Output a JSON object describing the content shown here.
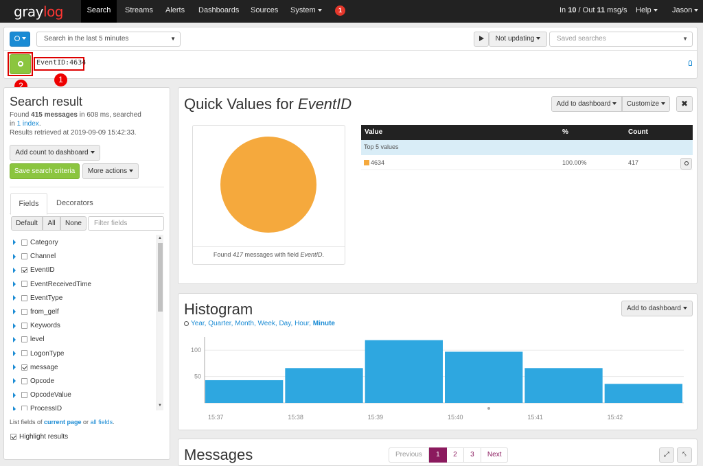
{
  "nav": {
    "logo_a": "gray",
    "logo_b": "log",
    "items": [
      "Search",
      "Streams",
      "Alerts",
      "Dashboards",
      "Sources",
      "System"
    ],
    "badge": "1",
    "throughput_prefix": "In ",
    "throughput_in": "10",
    "throughput_mid": " / Out ",
    "throughput_out": "11",
    "throughput_suffix": " msg/s",
    "help": "Help",
    "user": "Jason"
  },
  "search": {
    "range": "Search in the last 5 minutes",
    "updating": "Not updating",
    "saved_placeholder": "Saved searches",
    "query": "EventID:4634",
    "annotation_1": "1",
    "annotation_2": "2"
  },
  "sidebar": {
    "title": "Search result",
    "found_prefix": "Found ",
    "found_count": "415 messages",
    "found_mid": " in 608 ms, searched",
    "in_prefix": "in ",
    "index_link": "1 index",
    "in_suffix": ".",
    "retrieved": "Results retrieved at 2019-09-09 15:42:33.",
    "add_count": "Add count to dashboard",
    "save_criteria": "Save search criteria",
    "more_actions": "More actions",
    "tab_fields": "Fields",
    "tab_decorators": "Decorators",
    "filter_default": "Default",
    "filter_all": "All",
    "filter_none": "None",
    "filter_placeholder": "Filter fields",
    "fields": [
      {
        "name": "Category",
        "checked": false
      },
      {
        "name": "Channel",
        "checked": false
      },
      {
        "name": "EventID",
        "checked": true
      },
      {
        "name": "EventReceivedTime",
        "checked": false
      },
      {
        "name": "EventType",
        "checked": false
      },
      {
        "name": "from_gelf",
        "checked": false
      },
      {
        "name": "Keywords",
        "checked": false
      },
      {
        "name": "level",
        "checked": false
      },
      {
        "name": "LogonType",
        "checked": false
      },
      {
        "name": "message",
        "checked": true
      },
      {
        "name": "Opcode",
        "checked": false
      },
      {
        "name": "OpcodeValue",
        "checked": false
      },
      {
        "name": "ProcessID",
        "checked": false
      }
    ],
    "list_fields_prefix": "List fields of ",
    "current_page": "current page",
    "list_fields_mid": " or ",
    "all_fields": "all fields",
    "list_fields_suffix": ".",
    "highlight": "Highlight results"
  },
  "quick_values": {
    "title_prefix": "Quick Values for ",
    "title_field": "EventID",
    "add_to_dashboard": "Add to dashboard",
    "customize": "Customize",
    "pie_caption_prefix": "Found ",
    "pie_caption_count": "417",
    "pie_caption_mid": " messages with field ",
    "pie_caption_field": "EventID",
    "pie_caption_suffix": ".",
    "table_headers": [
      "Value",
      "%",
      "Count"
    ],
    "group_label": "Top 5 values",
    "rows": [
      {
        "value": "4634",
        "percent": "100.00%",
        "count": "417",
        "color": "#f5a93d"
      }
    ]
  },
  "histogram": {
    "title": "Histogram",
    "add_to_dashboard": "Add to dashboard",
    "resolutions": [
      "Year",
      "Quarter",
      "Month",
      "Week",
      "Day",
      "Hour",
      "Minute"
    ],
    "active_resolution": "Minute"
  },
  "messages": {
    "title": "Messages",
    "pager": [
      "Previous",
      "1",
      "2",
      "3",
      "Next"
    ]
  },
  "chart_data": {
    "type": "bar",
    "categories": [
      "15:37",
      "15:38",
      "15:39",
      "15:40",
      "15:41",
      "15:42"
    ],
    "values": [
      43,
      66,
      119,
      97,
      66,
      36
    ],
    "ylim": [
      0,
      125
    ],
    "yticks": [
      50,
      100
    ],
    "color": "#2ea7e0"
  }
}
